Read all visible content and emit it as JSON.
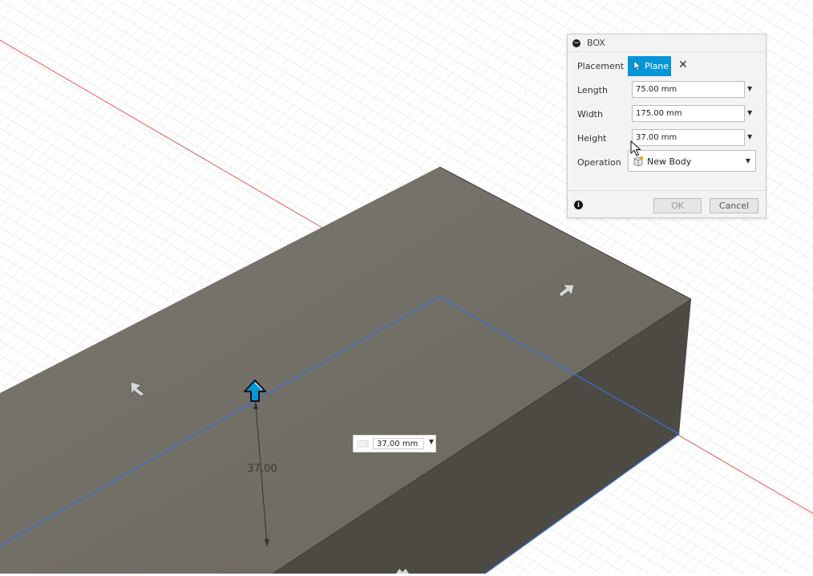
{
  "viewport": {
    "height_label": "37.00",
    "dimension_input": {
      "value": "37.00 mm"
    },
    "colors": {
      "body_top": "#6f6c64",
      "body_side": "#4d4a44",
      "edge": "#3a6fd0",
      "grid": "#d9d9d9",
      "axis_red": "#e45a5a",
      "handle_blue": "#0696d7"
    }
  },
  "panel": {
    "title": "BOX",
    "placement_label": "Placement",
    "plane_button_label": "Plane",
    "length": {
      "label": "Length",
      "value": "75.00 mm"
    },
    "width": {
      "label": "Width",
      "value": "175.00 mm"
    },
    "height": {
      "label": "Height",
      "value": "37.00 mm"
    },
    "operation": {
      "label": "Operation",
      "value": "New Body"
    },
    "ok_label": "OK",
    "cancel_label": "Cancel"
  }
}
